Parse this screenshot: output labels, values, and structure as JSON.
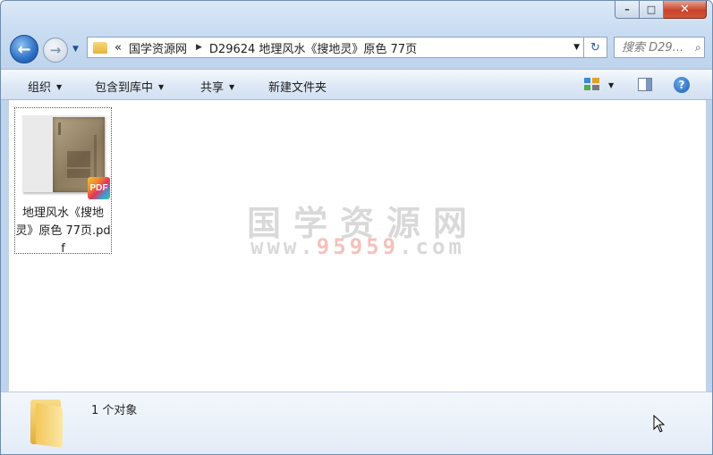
{
  "window": {
    "caption_buttons": {
      "minimize": "–",
      "maximize": "□",
      "close": "✕"
    }
  },
  "nav": {
    "back_icon": "arrow-left-icon",
    "forward_icon": "arrow-right-icon",
    "address": {
      "chevron": "«",
      "crumbs": [
        "国学资源网",
        "D29624 地理风水《搜地灵》原色 77页"
      ]
    },
    "search_placeholder": "搜索 D29..."
  },
  "toolbar": {
    "organize": "组织",
    "include_in_library": "包含到库中",
    "share": "共享",
    "new_folder": "新建文件夹",
    "help": "?"
  },
  "files": [
    {
      "name": "地理风水《搜地灵》原色 77页.pdf",
      "badge": "PDF",
      "type_icon": "pdf-icon"
    }
  ],
  "watermark": {
    "line1": "国学资源网",
    "line2_prefix": "www.",
    "line2_digits": "95959",
    "line2_suffix": ".com"
  },
  "details": {
    "count": "1 个对象"
  }
}
